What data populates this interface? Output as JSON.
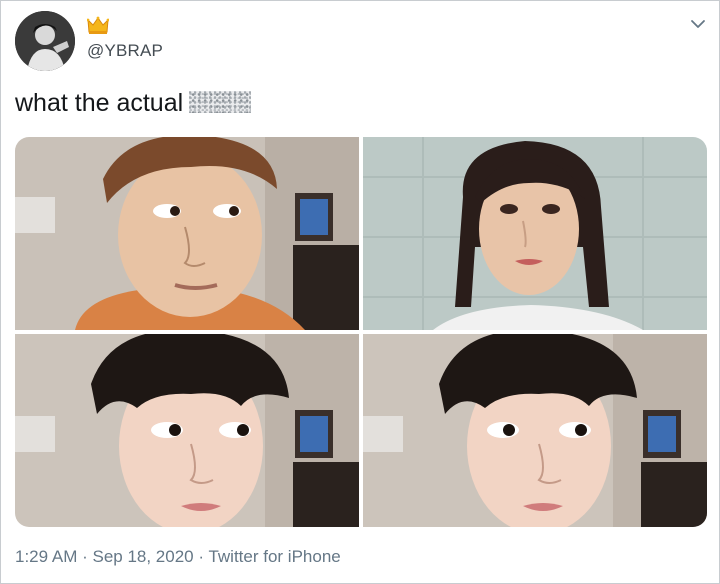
{
  "author": {
    "handle": "@YBRAP",
    "badge_icon": "crown-icon",
    "avatar_icon": "avatar"
  },
  "tweet": {
    "text": "what the actual",
    "censored_word": "censored-word"
  },
  "media": [
    {
      "description_icon": "man-selfie-photo"
    },
    {
      "description_icon": "woman-portrait-photo"
    },
    {
      "description_icon": "edited-selfie-photo"
    },
    {
      "description_icon": "edited-selfie-photo"
    }
  ],
  "meta": {
    "time": "1:29 AM",
    "separator1": " · ",
    "date": "Sep 18, 2020",
    "separator2": " · ",
    "source": "Twitter for iPhone"
  },
  "colors": {
    "text": "#14171a",
    "secondary": "#657786",
    "border": "#c8ccd0"
  }
}
